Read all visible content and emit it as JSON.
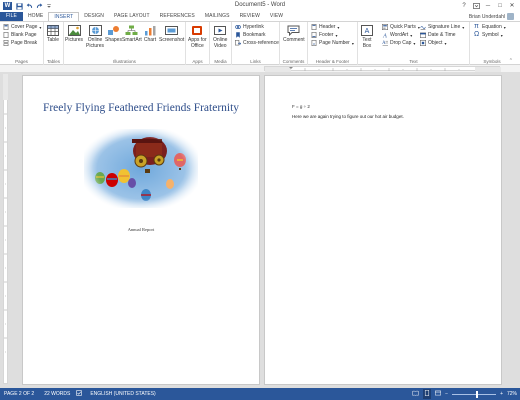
{
  "titlebar": {
    "app_icon": "W",
    "title": "Document5 - Word",
    "qat_icons": [
      "save-icon",
      "undo-icon",
      "redo-icon",
      "customize-icon"
    ],
    "controls": {
      "help": "?",
      "minimize": "─",
      "restore": "□",
      "close": "✕"
    }
  },
  "tabs": [
    "FILE",
    "HOME",
    "INSERT",
    "DESIGN",
    "PAGE LAYOUT",
    "REFERENCES",
    "MAILINGS",
    "REVIEW",
    "VIEW"
  ],
  "active_tab": "INSERT",
  "user": {
    "name": "Brian Underdahl"
  },
  "ribbon": {
    "pages": {
      "label": "Pages",
      "cover_page": "Cover Page",
      "blank_page": "Blank Page",
      "page_break": "Page Break"
    },
    "tables": {
      "label": "Tables",
      "table": "Table"
    },
    "illustrations": {
      "label": "Illustrations",
      "pictures": "Pictures",
      "online_pictures_1": "Online",
      "online_pictures_2": "Pictures",
      "shapes": "Shapes",
      "smartart": "SmartArt",
      "chart": "Chart",
      "screenshot": "Screenshot"
    },
    "apps": {
      "label": "Apps",
      "apps_for_office_1": "Apps for",
      "apps_for_office_2": "Office"
    },
    "media": {
      "label": "Media",
      "online_video_1": "Online",
      "online_video_2": "Video"
    },
    "links": {
      "label": "Links",
      "hyperlink": "Hyperlink",
      "bookmark": "Bookmark",
      "cross_reference": "Cross-reference"
    },
    "comments": {
      "label": "Comments",
      "comment": "Comment"
    },
    "header_footer": {
      "label": "Header & Footer",
      "header": "Header",
      "footer": "Footer",
      "page_number": "Page Number"
    },
    "text": {
      "label": "Text",
      "text_box_1": "Text",
      "text_box_2": "Box",
      "quick_parts": "Quick Parts",
      "wordart": "WordArt",
      "drop_cap": "Drop Cap",
      "signature_line": "Signature Line",
      "date_time": "Date & Time",
      "object": "Object"
    },
    "symbols": {
      "label": "Symbols",
      "equation": "Equation",
      "symbol": "Symbol"
    }
  },
  "document": {
    "page1_title": "Freely Flying Feathered Friends Fraternity",
    "page1_caption": "Annual Report",
    "page2_equation": "F = g ÷ 2",
    "page2_text": "Here we are again trying to figure out our hot air budget."
  },
  "status": {
    "page": "PAGE 2 OF 2",
    "words": "22 WORDS",
    "language": "ENGLISH (UNITED STATES)",
    "zoom": "72%"
  },
  "colors": {
    "accent": "#2b579a",
    "title_text": "#2f4e8a",
    "page_bg": "#ffffff",
    "canvas_bg": "#dedede"
  }
}
